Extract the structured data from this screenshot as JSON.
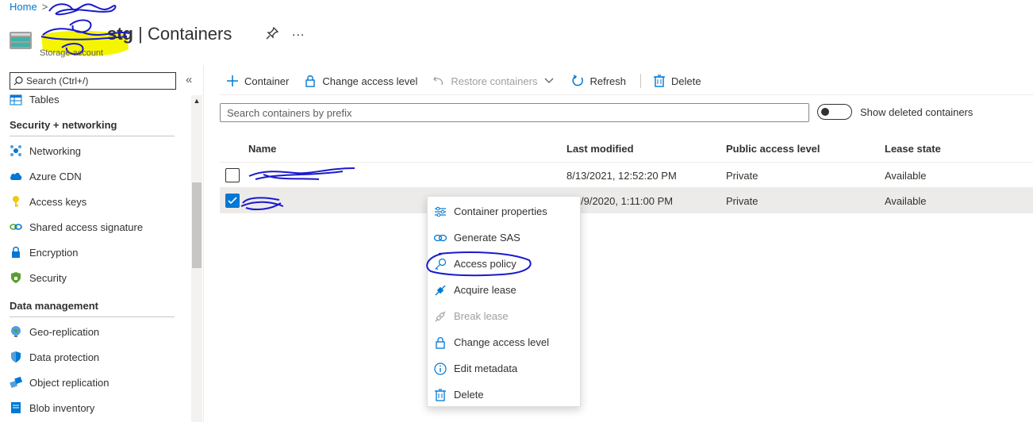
{
  "breadcrumb": {
    "home": "Home",
    "current": ""
  },
  "header": {
    "title_suffix": "stg",
    "title_divider": "|",
    "title_page": "Containers",
    "subtitle": "Storage account",
    "more": "..."
  },
  "nav": {
    "search_placeholder": "Search (Ctrl+/)",
    "collapse": "«",
    "items_top": [
      {
        "label": "Tables",
        "icon": "table-icon"
      }
    ],
    "section_security": "Security + networking",
    "security_items": [
      {
        "label": "Networking",
        "icon": "networking-icon"
      },
      {
        "label": "Azure CDN",
        "icon": "cloud-icon"
      },
      {
        "label": "Access keys",
        "icon": "key-icon"
      },
      {
        "label": "Shared access signature",
        "icon": "link-icon"
      },
      {
        "label": "Encryption",
        "icon": "lock-icon"
      },
      {
        "label": "Security",
        "icon": "shield-icon"
      }
    ],
    "section_data": "Data management",
    "data_items": [
      {
        "label": "Geo-replication",
        "icon": "globe-icon"
      },
      {
        "label": "Data protection",
        "icon": "shield-icon"
      },
      {
        "label": "Object replication",
        "icon": "replication-icon"
      },
      {
        "label": "Blob inventory",
        "icon": "inventory-icon"
      }
    ]
  },
  "toolbar": {
    "container": "Container",
    "change_access": "Change access level",
    "restore": "Restore containers",
    "refresh": "Refresh",
    "delete": "Delete"
  },
  "search": {
    "placeholder": "Search containers by prefix",
    "toggle_label": "Show deleted containers",
    "toggle_on": false
  },
  "table": {
    "headers": [
      "Name",
      "Last modified",
      "Public access level",
      "Lease state"
    ],
    "rows": [
      {
        "name": "",
        "modified": "8/13/2021, 12:52:20 PM",
        "access": "Private",
        "lease": "Available",
        "selected": false
      },
      {
        "name": "",
        "modified": "/9/2020, 1:11:00 PM",
        "access": "Private",
        "lease": "Available",
        "selected": true
      }
    ]
  },
  "context_menu": {
    "items": [
      {
        "label": "Container properties",
        "icon": "properties-icon",
        "disabled": false
      },
      {
        "label": "Generate SAS",
        "icon": "link-icon",
        "disabled": false
      },
      {
        "label": "Access policy",
        "icon": "key-icon",
        "disabled": false
      },
      {
        "label": "Acquire lease",
        "icon": "lease-icon",
        "disabled": false
      },
      {
        "label": "Break lease",
        "icon": "break-lease-icon",
        "disabled": true
      },
      {
        "label": "Change access level",
        "icon": "lock-icon",
        "disabled": false
      },
      {
        "label": "Edit metadata",
        "icon": "info-icon",
        "disabled": false
      },
      {
        "label": "Delete",
        "icon": "trash-icon",
        "disabled": false
      }
    ]
  },
  "colors": {
    "accent": "#0078d4",
    "scribble": "#1a1acc",
    "highlighter": "#f5f500"
  }
}
